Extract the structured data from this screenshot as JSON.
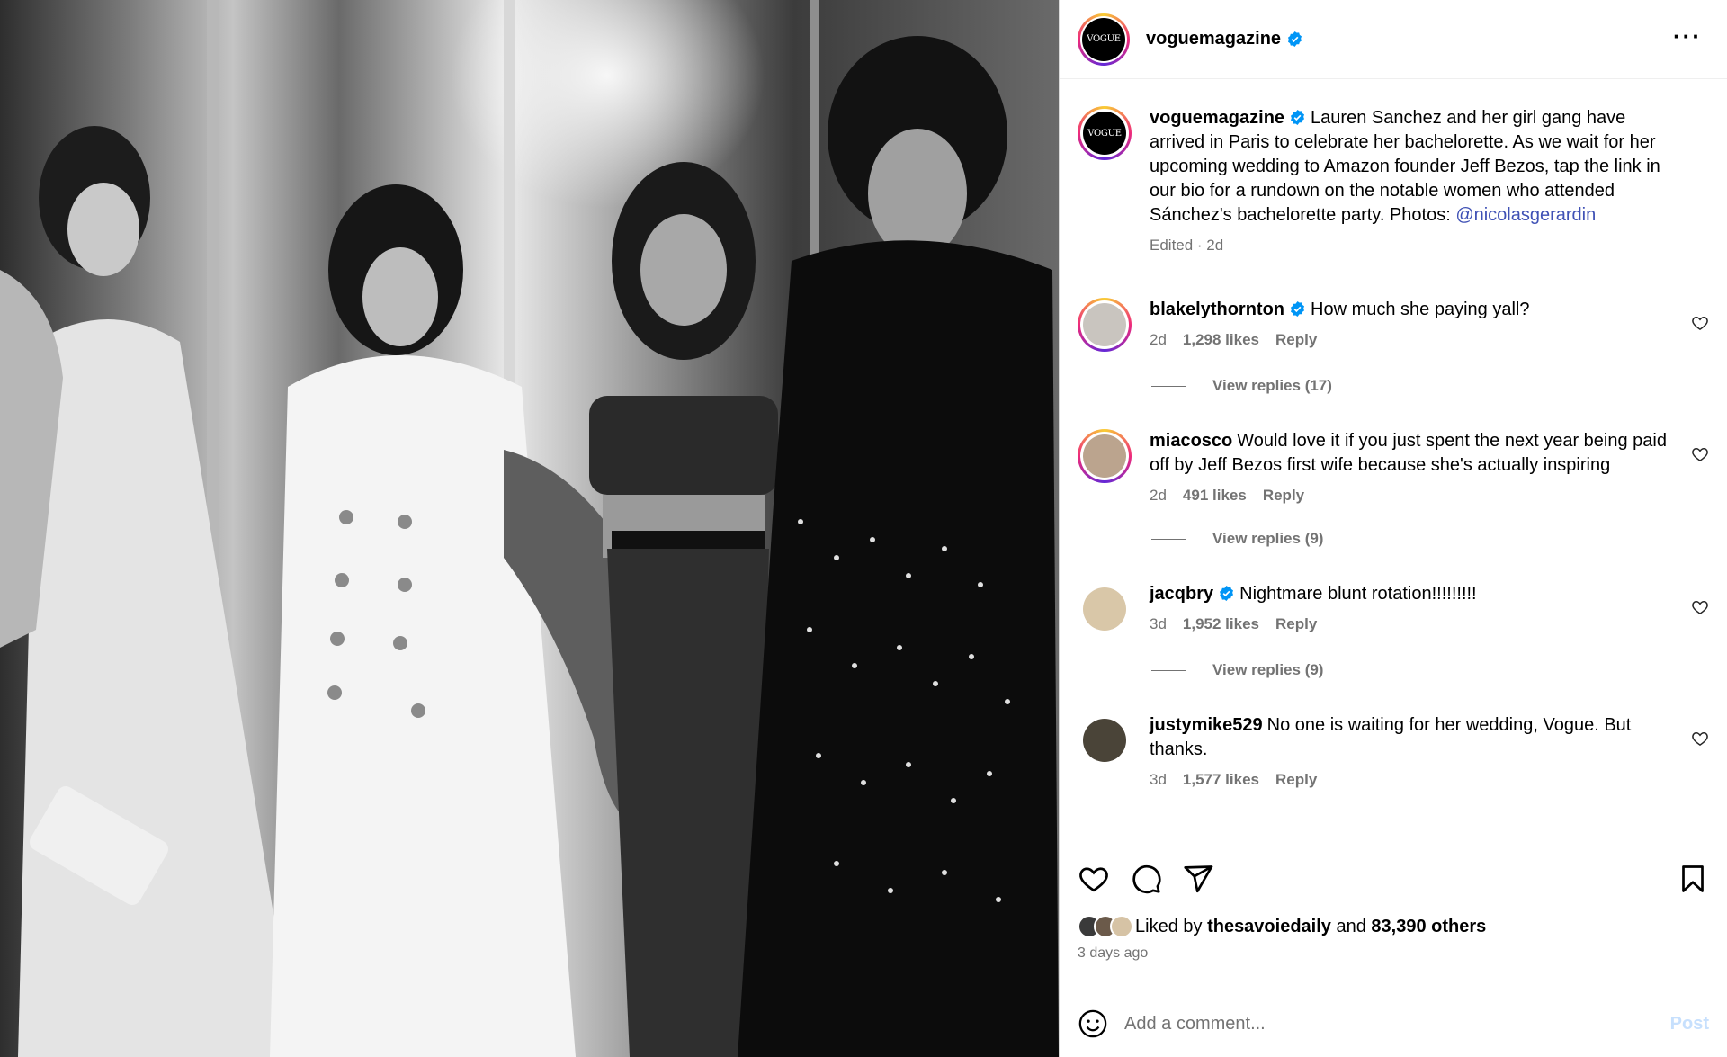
{
  "post": {
    "account": "voguemagazine",
    "avatar_text": "VOGUE",
    "more_icon": "more-horizontal-icon",
    "caption": {
      "username": "voguemagazine",
      "text": "Lauren Sanchez and her girl gang have arrived in Paris to celebrate her bachelorette. As we wait for her upcoming wedding to Amazon founder Jeff Bezos, tap the link in our bio for a rundown on the notable women who attended Sánchez's bachelorette party. Photos: ",
      "mention": "@nicolasgerardin",
      "meta": "Edited · 2d"
    }
  },
  "comments": [
    {
      "username": "blakelythornton",
      "verified": true,
      "text": "How much she paying yall?",
      "time": "2d",
      "likes": "1,298 likes",
      "reply": "Reply",
      "replies": "View replies (17)",
      "avatar_color": "#c9c5bf",
      "ring": true
    },
    {
      "username": "miacosco",
      "verified": false,
      "text": "Would love it if you just spent the next year being paid off by Jeff Bezos first wife because she's actually inspiring",
      "time": "2d",
      "likes": "491 likes",
      "reply": "Reply",
      "replies": "View replies (9)",
      "avatar_color": "#bba48e",
      "ring": true
    },
    {
      "username": "jacqbry",
      "verified": true,
      "text": "Nightmare blunt rotation!!!!!!!!!",
      "time": "3d",
      "likes": "1,952 likes",
      "reply": "Reply",
      "replies": "View replies (9)",
      "avatar_color": "#d9c7a8",
      "ring": false
    },
    {
      "username": "justymike529",
      "verified": false,
      "text": "No one is waiting for her wedding, Vogue. But thanks.",
      "time": "3d",
      "likes": "1,577 likes",
      "reply": "Reply",
      "replies": "",
      "avatar_color": "#4a4438",
      "ring": false
    }
  ],
  "actions": {
    "like_icon": "heart-icon",
    "comment_icon": "comment-icon",
    "share_icon": "send-icon",
    "save_icon": "bookmark-icon",
    "liked_by_prefix": "Liked by",
    "liked_by_user": "thesavoiedaily",
    "liked_by_and": "and",
    "liked_by_others": "83,390 others",
    "posted": "3 days ago"
  },
  "composer": {
    "emoji_icon": "emoji-icon",
    "placeholder": "Add a comment...",
    "post_label": "Post"
  },
  "colors": {
    "verified": "#0095f6",
    "link": "#3f51b5",
    "secondary": "#737373",
    "post_disabled": "#c7e0fd"
  }
}
